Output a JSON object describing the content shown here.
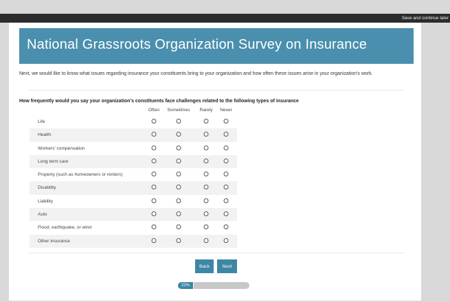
{
  "topbar": {
    "save_later": "Save and continue later"
  },
  "survey": {
    "title": "National Grassroots Organization Survey on Insurance",
    "intro": "Next, we would like to know what issues regarding insurance your constituents bring to your organization and how often these issues arise in your organization's work.",
    "question": "How frequently would you say your organization's constituents face challenges related to the following types of insurance"
  },
  "matrix": {
    "columns": [
      "Often",
      "Sometimes",
      "Rarely",
      "Never"
    ],
    "rows": [
      "Life",
      "Health",
      "Workers' compensation",
      "Long term care",
      "Property (such as homeowners or renters)",
      "Disability",
      "Liability",
      "Auto",
      "Flood, earthquake, or wind",
      "Other insurance"
    ]
  },
  "nav": {
    "back_label": "Back",
    "next_label": "Next"
  },
  "progress": {
    "percent": 22,
    "label": "22%"
  },
  "colors": {
    "accent": "#4a8fad",
    "button": "#3e86a5",
    "topbar": "#2c2c2c"
  }
}
